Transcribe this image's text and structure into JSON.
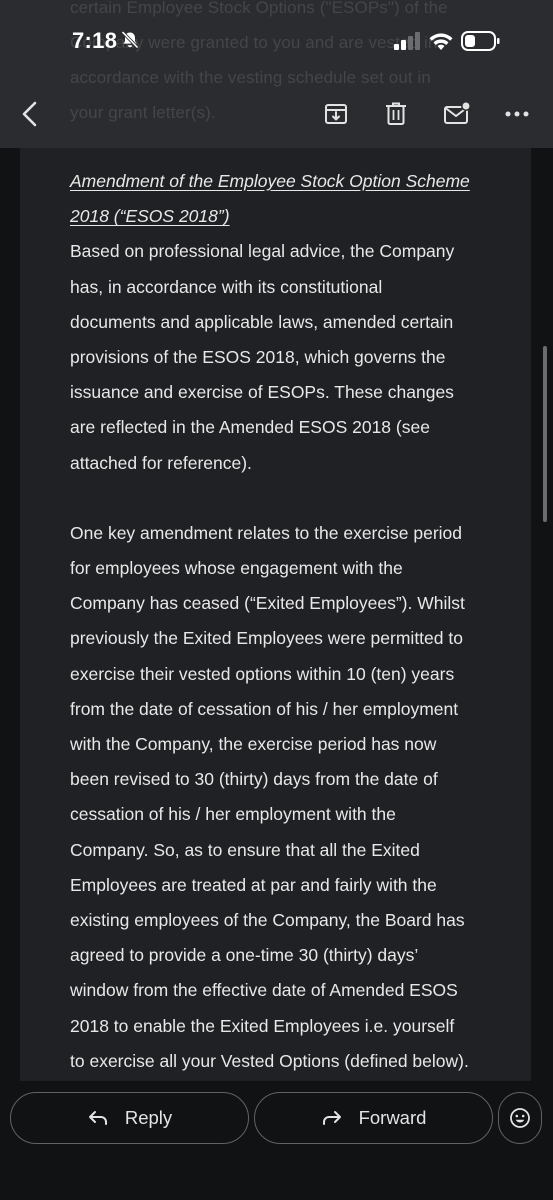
{
  "status_bar": {
    "time": "7:18"
  },
  "background_text": "certain Employee Stock Options (\"ESOPs\") of the\nCompany were granted to you and are vested in\naccordance with the vesting schedule set out in\nyour grant letter(s).",
  "toolbar": {
    "back_icon": "arrow-back-icon",
    "archive_icon": "archive-icon",
    "delete_icon": "trash-icon",
    "mark_unread_icon": "mail-unread-icon",
    "more_icon": "more-horizontal-icon"
  },
  "email": {
    "heading_line1": "Amendment of the Employee Stock Option Scheme",
    "heading_line2": "2018 (“ESOS 2018”)",
    "para1": [
      "Based on professional legal advice, the Company",
      "has, in accordance with its constitutional",
      "documents and applicable laws, amended certain",
      "provisions of the ESOS 2018, which governs the",
      "issuance and exercise of ESOPs. These changes",
      "are reflected in the Amended ESOS 2018 (see",
      "attached for reference)."
    ],
    "para2": [
      "One key amendment relates to the exercise period",
      "for employees whose engagement with the",
      "Company has ceased (“Exited Employees”). Whilst",
      "previously the Exited Employees were permitted to",
      "exercise their vested options within 10 (ten) years",
      "from the date of cessation of his / her employment",
      "with the Company, the exercise period has now",
      "been revised to 30 (thirty) days from the date of",
      "cessation of his / her employment with the",
      "Company. So, as to ensure that all the Exited",
      "Employees are treated at par and fairly with the",
      "existing employees of the Company, the Board has",
      "agreed to provide a one-time 30 (thirty) days’",
      "window from the effective date of Amended ESOS",
      "2018 to enable the Exited Employees i.e. yourself",
      "to exercise all your Vested Options (defined below)."
    ]
  },
  "actions": {
    "reply_label": "Reply",
    "forward_label": "Forward",
    "emoji_icon": "emoji-reaction-icon"
  },
  "colors": {
    "background": "#111213",
    "card": "#202124",
    "appbar": "#2b2c2f",
    "text": "#e8e8e8",
    "outline": "#5f6368"
  }
}
